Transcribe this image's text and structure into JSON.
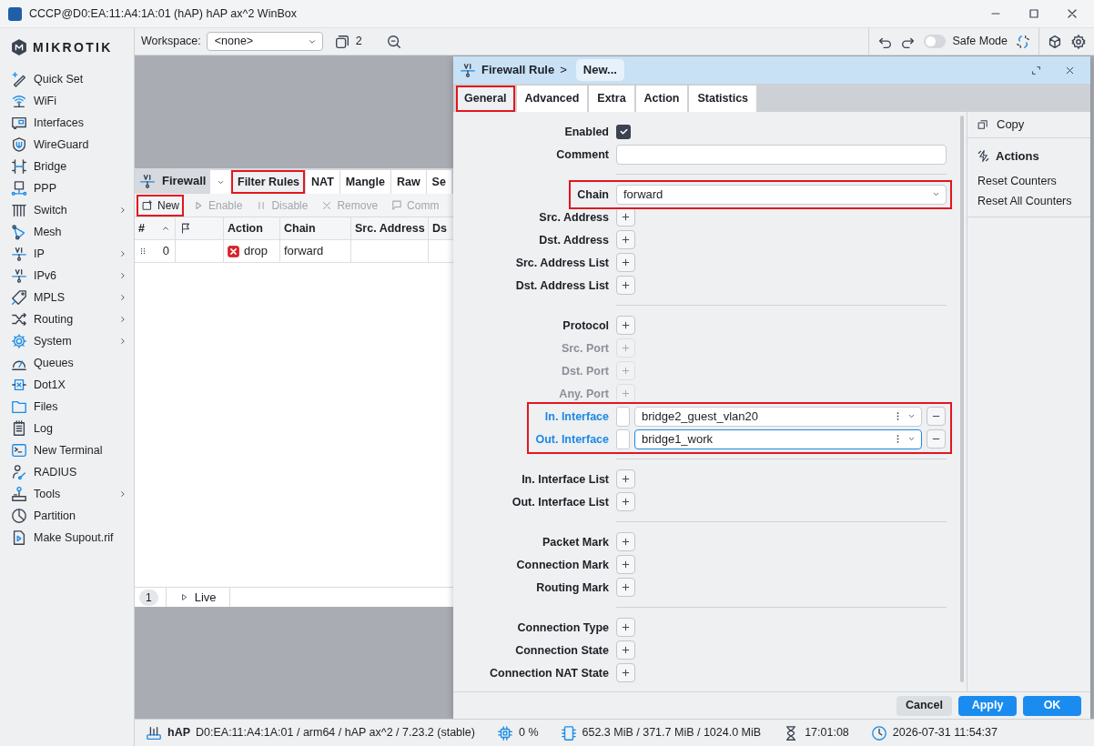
{
  "window": {
    "title": "CCCP@D0:EA:11:A4:1A:01 (hAP) hAP ax^2 WinBox"
  },
  "logo": "MIKROTIK",
  "sidebar": {
    "items": [
      {
        "label": "Quick Set",
        "has_submenu": false
      },
      {
        "label": "WiFi",
        "has_submenu": false
      },
      {
        "label": "Interfaces",
        "has_submenu": false
      },
      {
        "label": "WireGuard",
        "has_submenu": false
      },
      {
        "label": "Bridge",
        "has_submenu": false
      },
      {
        "label": "PPP",
        "has_submenu": false
      },
      {
        "label": "Switch",
        "has_submenu": true
      },
      {
        "label": "Mesh",
        "has_submenu": false
      },
      {
        "label": "IP",
        "has_submenu": true
      },
      {
        "label": "IPv6",
        "has_submenu": true
      },
      {
        "label": "MPLS",
        "has_submenu": true
      },
      {
        "label": "Routing",
        "has_submenu": true
      },
      {
        "label": "System",
        "has_submenu": true
      },
      {
        "label": "Queues",
        "has_submenu": false
      },
      {
        "label": "Dot1X",
        "has_submenu": false
      },
      {
        "label": "Files",
        "has_submenu": false
      },
      {
        "label": "Log",
        "has_submenu": false
      },
      {
        "label": "New Terminal",
        "has_submenu": false
      },
      {
        "label": "RADIUS",
        "has_submenu": false
      },
      {
        "label": "Tools",
        "has_submenu": true
      },
      {
        "label": "Partition",
        "has_submenu": false
      },
      {
        "label": "Make Supout.rif",
        "has_submenu": false
      }
    ]
  },
  "toolbar": {
    "workspace_label": "Workspace:",
    "workspace_value": "<none>",
    "window_count": "2",
    "safe_mode_label": "Safe Mode",
    "safe_mode_on": false
  },
  "firewall_window": {
    "title": "Firewall",
    "tabs": [
      {
        "label": "Filter Rules",
        "selected": true,
        "highlighted": true
      },
      {
        "label": "NAT",
        "selected": false,
        "highlighted": false
      },
      {
        "label": "Mangle",
        "selected": false,
        "highlighted": false
      },
      {
        "label": "Raw",
        "selected": false,
        "highlighted": false
      },
      {
        "label": "Se",
        "selected": false,
        "highlighted": false
      }
    ],
    "actions": [
      {
        "label": "New",
        "disabled": false,
        "highlighted": true
      },
      {
        "label": "Enable",
        "disabled": true,
        "highlighted": false
      },
      {
        "label": "Disable",
        "disabled": true,
        "highlighted": false
      },
      {
        "label": "Remove",
        "disabled": true,
        "highlighted": false
      },
      {
        "label": "Comm",
        "disabled": true,
        "highlighted": false
      }
    ],
    "columns": [
      {
        "kind": "text",
        "label": "#",
        "sorted": true
      },
      {
        "kind": "flag"
      },
      {
        "kind": "text",
        "label": "Action",
        "sorted": false
      },
      {
        "kind": "text",
        "label": "Chain",
        "sorted": false
      },
      {
        "kind": "text",
        "label": "Src. Address"
      },
      {
        "kind": "text",
        "label": "Ds"
      }
    ],
    "rows": [
      {
        "number": "0",
        "action": "drop",
        "chain": "forward"
      }
    ],
    "row_count": "1",
    "live_label": "Live"
  },
  "rule_dialog": {
    "title": "Firewall Rule",
    "breadcrumb_separator": ">",
    "breadcrumb": "New...",
    "tabs": [
      {
        "label": "General",
        "selected": true,
        "highlighted": true
      },
      {
        "label": "Advanced",
        "selected": false,
        "highlighted": false
      },
      {
        "label": "Extra",
        "selected": false,
        "highlighted": false
      },
      {
        "label": "Action",
        "selected": false,
        "highlighted": false
      },
      {
        "label": "Statistics",
        "selected": false,
        "highlighted": false
      }
    ],
    "sections": [
      {
        "fields": [
          {
            "label": "Enabled",
            "kind": "checkbox",
            "checked": true
          },
          {
            "label": "Comment",
            "kind": "text"
          }
        ]
      },
      {
        "fields": [
          {
            "label": "Chain",
            "kind": "select",
            "value": "forward",
            "highlighted": true
          },
          {
            "label": "Src. Address",
            "kind": "add",
            "disabled": false
          },
          {
            "label": "Dst. Address",
            "kind": "add",
            "disabled": false
          },
          {
            "label": "Src. Address List",
            "kind": "add",
            "disabled": false
          },
          {
            "label": "Dst. Address List",
            "kind": "add",
            "disabled": false
          }
        ]
      },
      {
        "fields": [
          {
            "label": "Protocol",
            "kind": "add",
            "disabled": false
          },
          {
            "label": "Src. Port",
            "kind": "add",
            "disabled": true
          },
          {
            "label": "Dst. Port",
            "kind": "add",
            "disabled": true
          },
          {
            "label": "Any. Port",
            "kind": "add",
            "disabled": true
          },
          {
            "label": "In. Interface",
            "kind": "interface",
            "value": "bridge2_guest_vlan20",
            "focused": false,
            "highlighted": true
          },
          {
            "label": "Out. Interface",
            "kind": "interface",
            "value": "bridge1_work",
            "focused": true,
            "highlighted": true
          }
        ]
      },
      {
        "fields": [
          {
            "label": "In. Interface List",
            "kind": "add",
            "disabled": false
          },
          {
            "label": "Out. Interface List",
            "kind": "add",
            "disabled": false
          }
        ]
      },
      {
        "fields": [
          {
            "label": "Packet Mark",
            "kind": "add",
            "disabled": false
          },
          {
            "label": "Connection Mark",
            "kind": "add",
            "disabled": false
          },
          {
            "label": "Routing Mark",
            "kind": "add",
            "disabled": false
          }
        ]
      },
      {
        "fields": [
          {
            "label": "Connection Type",
            "kind": "add",
            "disabled": false
          },
          {
            "label": "Connection State",
            "kind": "add",
            "disabled": false
          },
          {
            "label": "Connection NAT State",
            "kind": "add",
            "disabled": false
          }
        ]
      }
    ],
    "side_panel": {
      "copy": "Copy",
      "actions_title": "Actions",
      "actions": [
        "Reset Counters",
        "Reset All Counters"
      ]
    },
    "buttons": [
      {
        "label": "Cancel",
        "kind": "secondary"
      },
      {
        "label": "Apply",
        "kind": "primary"
      },
      {
        "label": "OK",
        "kind": "primary"
      }
    ]
  },
  "status_bar": {
    "device": "hAP",
    "info": "D0:EA:11:A4:1A:01 / arm64 / hAP ax^2 / 7.23.2 (stable)",
    "cpu": "0 %",
    "memory": "652.3 MiB / 371.7 MiB / 1024.0 MiB",
    "uptime": "17:01:08",
    "clock": "2026-07-31 11:54:37"
  }
}
